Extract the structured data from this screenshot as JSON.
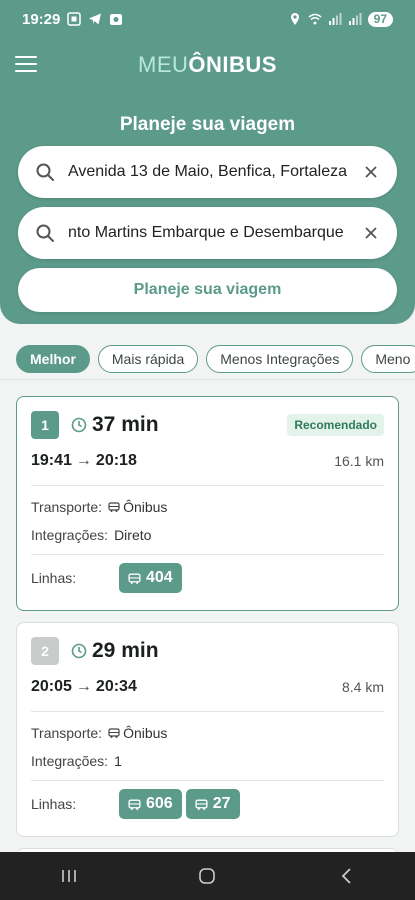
{
  "status_bar": {
    "time": "19:29",
    "battery": "97"
  },
  "header": {
    "logo_part1": "MEU",
    "logo_part2": "ÔNIBUS",
    "planner_title": "Planeje sua viagem",
    "origin_value": "Avenida 13 de Maio, Benfica, Fortaleza",
    "destination_value": "nto Martins Embarque e Desembarque",
    "plan_button": "Planeje sua viagem"
  },
  "filters": [
    "Melhor",
    "Mais rápida",
    "Menos Integrações",
    "Meno"
  ],
  "active_filter": "Melhor",
  "routes": [
    {
      "rank": "1",
      "duration": "37 min",
      "badge": "Recomendado",
      "depart": "19:41",
      "arrive": "20:18",
      "distance": "16.1 km",
      "transport_label": "Transporte:",
      "transport": "Ônibus",
      "integrations_label": "Integrações:",
      "integrations": "Direto",
      "lines_label": "Linhas:",
      "lines": [
        "404"
      ]
    },
    {
      "rank": "2",
      "duration": "29 min",
      "depart": "20:05",
      "arrive": "20:34",
      "distance": "8.4 km",
      "transport_label": "Transporte:",
      "transport": "Ônibus",
      "integrations_label": "Integrações:",
      "integrations": "1",
      "lines_label": "Linhas:",
      "lines": [
        "606",
        "27"
      ]
    }
  ],
  "colors": {
    "primary": "#5c9a8a",
    "badge_bg": "#e3f3ec",
    "badge_text": "#2f7a5f"
  },
  "icons": [
    "menu-icon",
    "search-icon",
    "close-icon",
    "clock-icon",
    "bus-icon",
    "recent-apps-icon",
    "home-icon",
    "back-icon"
  ]
}
